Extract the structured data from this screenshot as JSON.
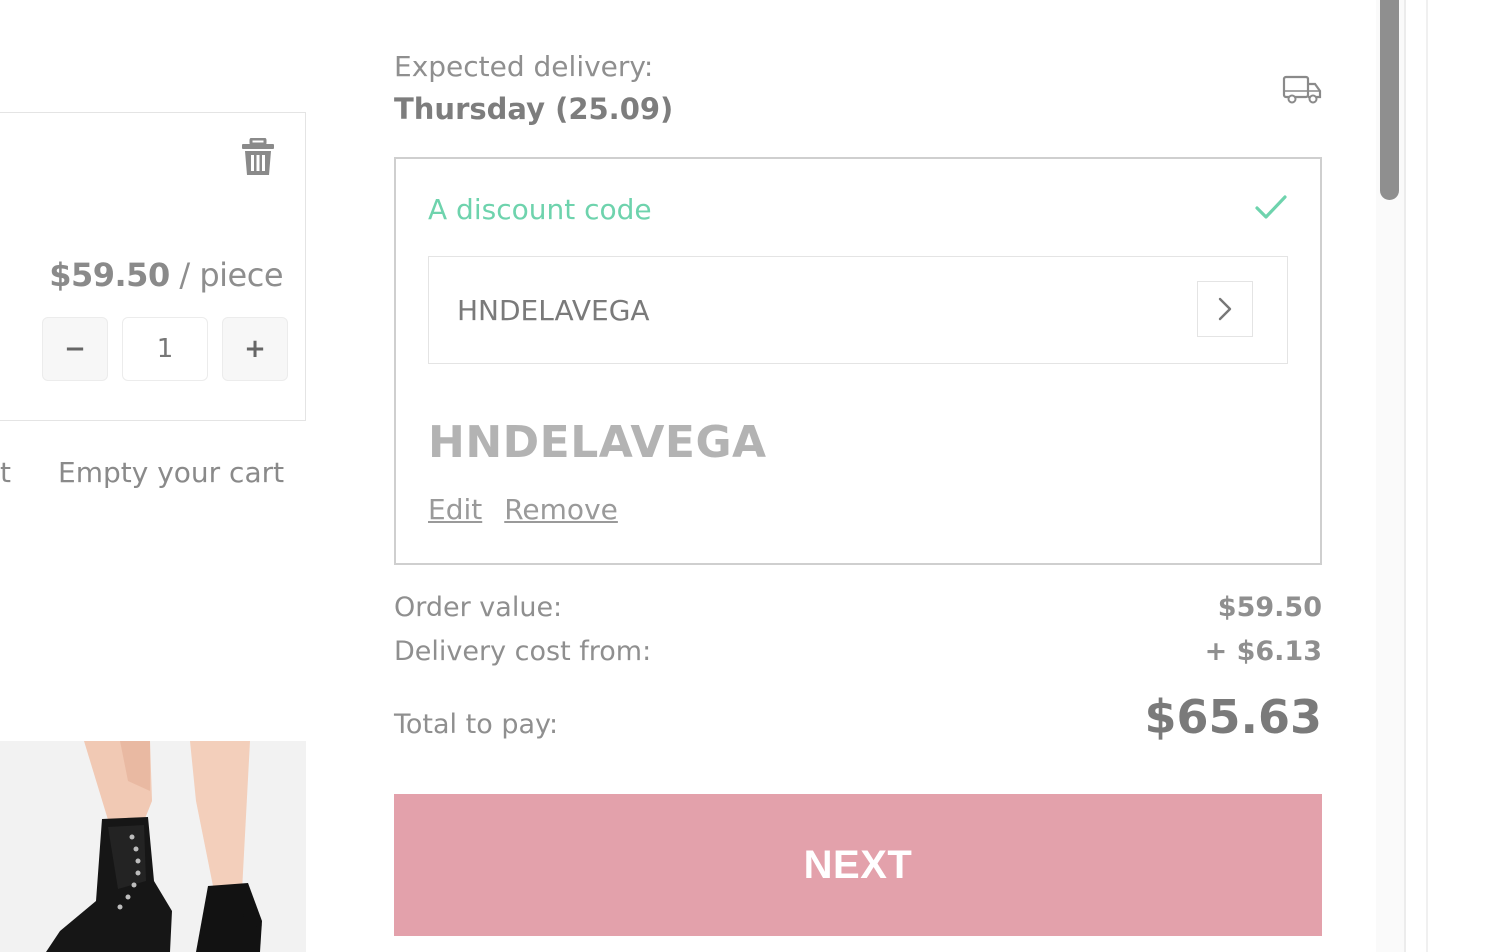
{
  "cart_item": {
    "price": "$59.50",
    "price_separator": "/",
    "price_unit": "piece",
    "quantity": "1",
    "decrement_label": "−",
    "increment_label": "+",
    "partial_link": "t",
    "empty_cart_label": "Empty your cart"
  },
  "delivery": {
    "label": "Expected delivery:",
    "date": "Thursday (25.09)",
    "icon": "truck-icon"
  },
  "discount": {
    "title": "A discount code",
    "status_icon": "check-icon",
    "input_value": "HNDELAVEGA",
    "submit_icon": "chevron-right-icon",
    "applied_code": "HNDELAVEGA",
    "edit_label": "Edit",
    "remove_label": "Remove"
  },
  "totals": {
    "order_value_label": "Order value:",
    "order_value": "$59.50",
    "delivery_cost_label": "Delivery cost from:",
    "delivery_cost": "+ $6.13",
    "total_label": "Total to pay:",
    "total": "$65.63"
  },
  "next_button_label": "NEXT",
  "colors": {
    "accent_green": "#6ed3ad",
    "next_button": "#e3a1ab",
    "border": "#cfcfcf"
  }
}
